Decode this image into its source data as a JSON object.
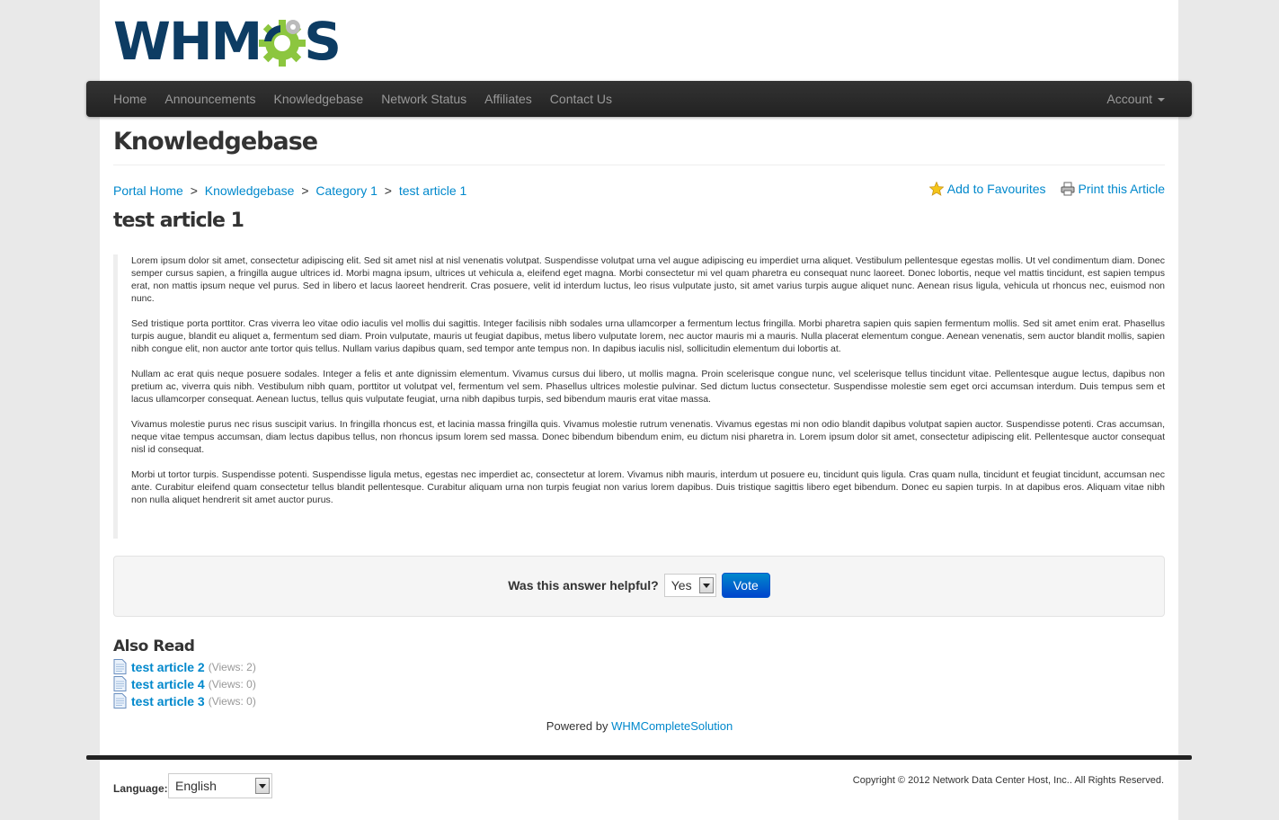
{
  "logo": {
    "text_a": "WHM",
    "text_b": "S"
  },
  "nav": {
    "items": [
      "Home",
      "Announcements",
      "Knowledgebase",
      "Network Status",
      "Affiliates",
      "Contact Us"
    ],
    "account": "Account"
  },
  "page": {
    "title": "Knowledgebase"
  },
  "breadcrumb": {
    "items": [
      "Portal Home",
      "Knowledgebase",
      "Category 1",
      "test article 1"
    ],
    "sep": ">"
  },
  "tools": {
    "favourites": "Add to Favourites",
    "print": "Print this Article"
  },
  "article": {
    "title": "test article 1",
    "paragraphs": [
      "Lorem ipsum dolor sit amet, consectetur adipiscing elit. Sed sit amet nisl at nisl venenatis volutpat. Suspendisse volutpat urna vel augue adipiscing eu imperdiet urna aliquet. Vestibulum pellentesque egestas mollis. Ut vel condimentum diam. Donec semper cursus sapien, a fringilla augue ultrices id. Morbi magna ipsum, ultrices ut vehicula a, eleifend eget magna. Morbi consectetur mi vel quam pharetra eu consequat nunc laoreet. Donec lobortis, neque vel mattis tincidunt, est sapien tempus erat, non mattis ipsum neque vel purus. Sed in libero et lacus laoreet hendrerit. Cras posuere, velit id interdum luctus, leo risus vulputate justo, sit amet varius turpis augue aliquet nunc. Aenean risus ligula, vehicula ut rhoncus nec, euismod non nunc.",
      "Sed tristique porta porttitor. Cras viverra leo vitae odio iaculis vel mollis dui sagittis. Integer facilisis nibh sodales urna ullamcorper a fermentum lectus fringilla. Morbi pharetra sapien quis sapien fermentum mollis. Sed sit amet enim erat. Phasellus turpis augue, blandit eu aliquet a, fermentum sed diam. Proin vulputate, mauris ut feugiat dapibus, metus libero vulputate lorem, nec auctor mauris mi a mauris. Nulla placerat elementum congue. Aenean venenatis, sem auctor blandit mollis, sapien nibh congue elit, non auctor ante tortor quis tellus. Nullam varius dapibus quam, sed tempor ante tempus non. In dapibus iaculis nisl, sollicitudin elementum dui lobortis at.",
      "Nullam ac erat quis neque posuere sodales. Integer a felis et ante dignissim elementum. Vivamus cursus dui libero, ut mollis magna. Proin scelerisque congue nunc, vel scelerisque tellus tincidunt vitae. Pellentesque augue lectus, dapibus non pretium ac, viverra quis nibh. Vestibulum nibh quam, porttitor ut volutpat vel, fermentum vel sem. Phasellus ultrices molestie pulvinar. Sed dictum luctus consectetur. Suspendisse molestie sem eget orci accumsan interdum. Duis tempus sem et lacus ullamcorper consequat. Aenean luctus, tellus quis vulputate feugiat, urna nibh dapibus turpis, sed bibendum mauris erat vitae massa.",
      "Vivamus molestie purus nec risus suscipit varius. In fringilla rhoncus est, et lacinia massa fringilla quis. Vivamus molestie rutrum venenatis. Vivamus egestas mi non odio blandit dapibus volutpat sapien auctor. Suspendisse potenti. Cras accumsan, neque vitae tempus accumsan, diam lectus dapibus tellus, non rhoncus ipsum lorem sed massa. Donec bibendum bibendum enim, eu dictum nisi pharetra in. Lorem ipsum dolor sit amet, consectetur adipiscing elit. Pellentesque auctor consequat nisl id consequat.",
      "Morbi ut tortor turpis. Suspendisse potenti. Suspendisse ligula metus, egestas nec imperdiet ac, consectetur at lorem. Vivamus nibh mauris, interdum ut posuere eu, tincidunt quis ligula. Cras quam nulla, tincidunt et feugiat tincidunt, accumsan nec ante. Curabitur eleifend quam consectetur tellus blandit pellentesque. Curabitur aliquam urna non turpis feugiat non varius lorem dapibus. Duis tristique sagittis libero eget bibendum. Donec eu sapien turpis. In at dapibus eros. Aliquam vitae nibh non nulla aliquet hendrerit sit amet auctor purus."
    ]
  },
  "vote": {
    "question": "Was this answer helpful?",
    "selected": "Yes",
    "button": "Vote"
  },
  "also_read": {
    "title": "Also Read",
    "items": [
      {
        "title": "test article 2",
        "views": "(Views: 2)"
      },
      {
        "title": "test article 4",
        "views": "(Views: 0)"
      },
      {
        "title": "test article 3",
        "views": "(Views: 0)"
      }
    ]
  },
  "powered": {
    "prefix": "Powered by",
    "link": "WHMCompleteSolution"
  },
  "footer": {
    "language_label": "Language:",
    "language": "English",
    "copyright": "Copyright © 2012 Network Data Center Host, Inc.. All Rights Reserved."
  },
  "colors": {
    "link": "#0088cc",
    "logo_blue": "#0d3c63",
    "logo_green": "#8cc63f",
    "navbar": "#222222"
  }
}
